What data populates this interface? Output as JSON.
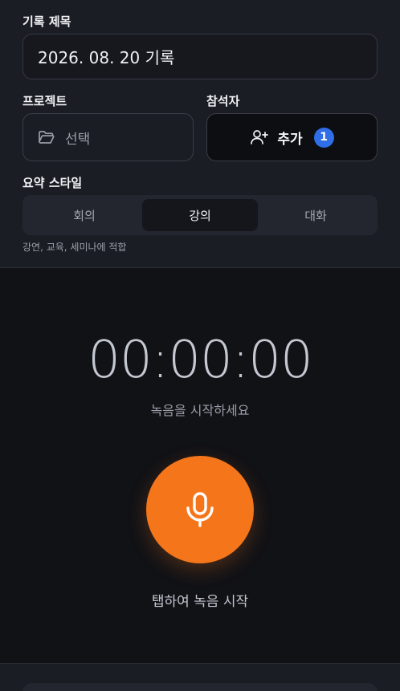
{
  "form": {
    "title_label": "기록 제목",
    "title_value": "2026. 08. 20 기록",
    "project_label": "프로젝트",
    "project_placeholder": "선택",
    "attendees_label": "참석자",
    "attendees_button": "추가",
    "attendees_count": "1",
    "style_label": "요약 스타일",
    "style_options": [
      "회의",
      "강의",
      "대화"
    ],
    "style_selected": "강의",
    "style_hint": "강연, 교육, 세미나에 적합"
  },
  "recorder": {
    "timer": "00:00:00",
    "status": "녹음을 시작하세요",
    "tap_label": "탭하여 녹음 시작"
  },
  "colors": {
    "accent": "#f5751a",
    "badge": "#2f6ee6"
  },
  "icons": {
    "project": "folder-icon",
    "attendees": "add-user-icon",
    "record": "microphone-icon"
  }
}
